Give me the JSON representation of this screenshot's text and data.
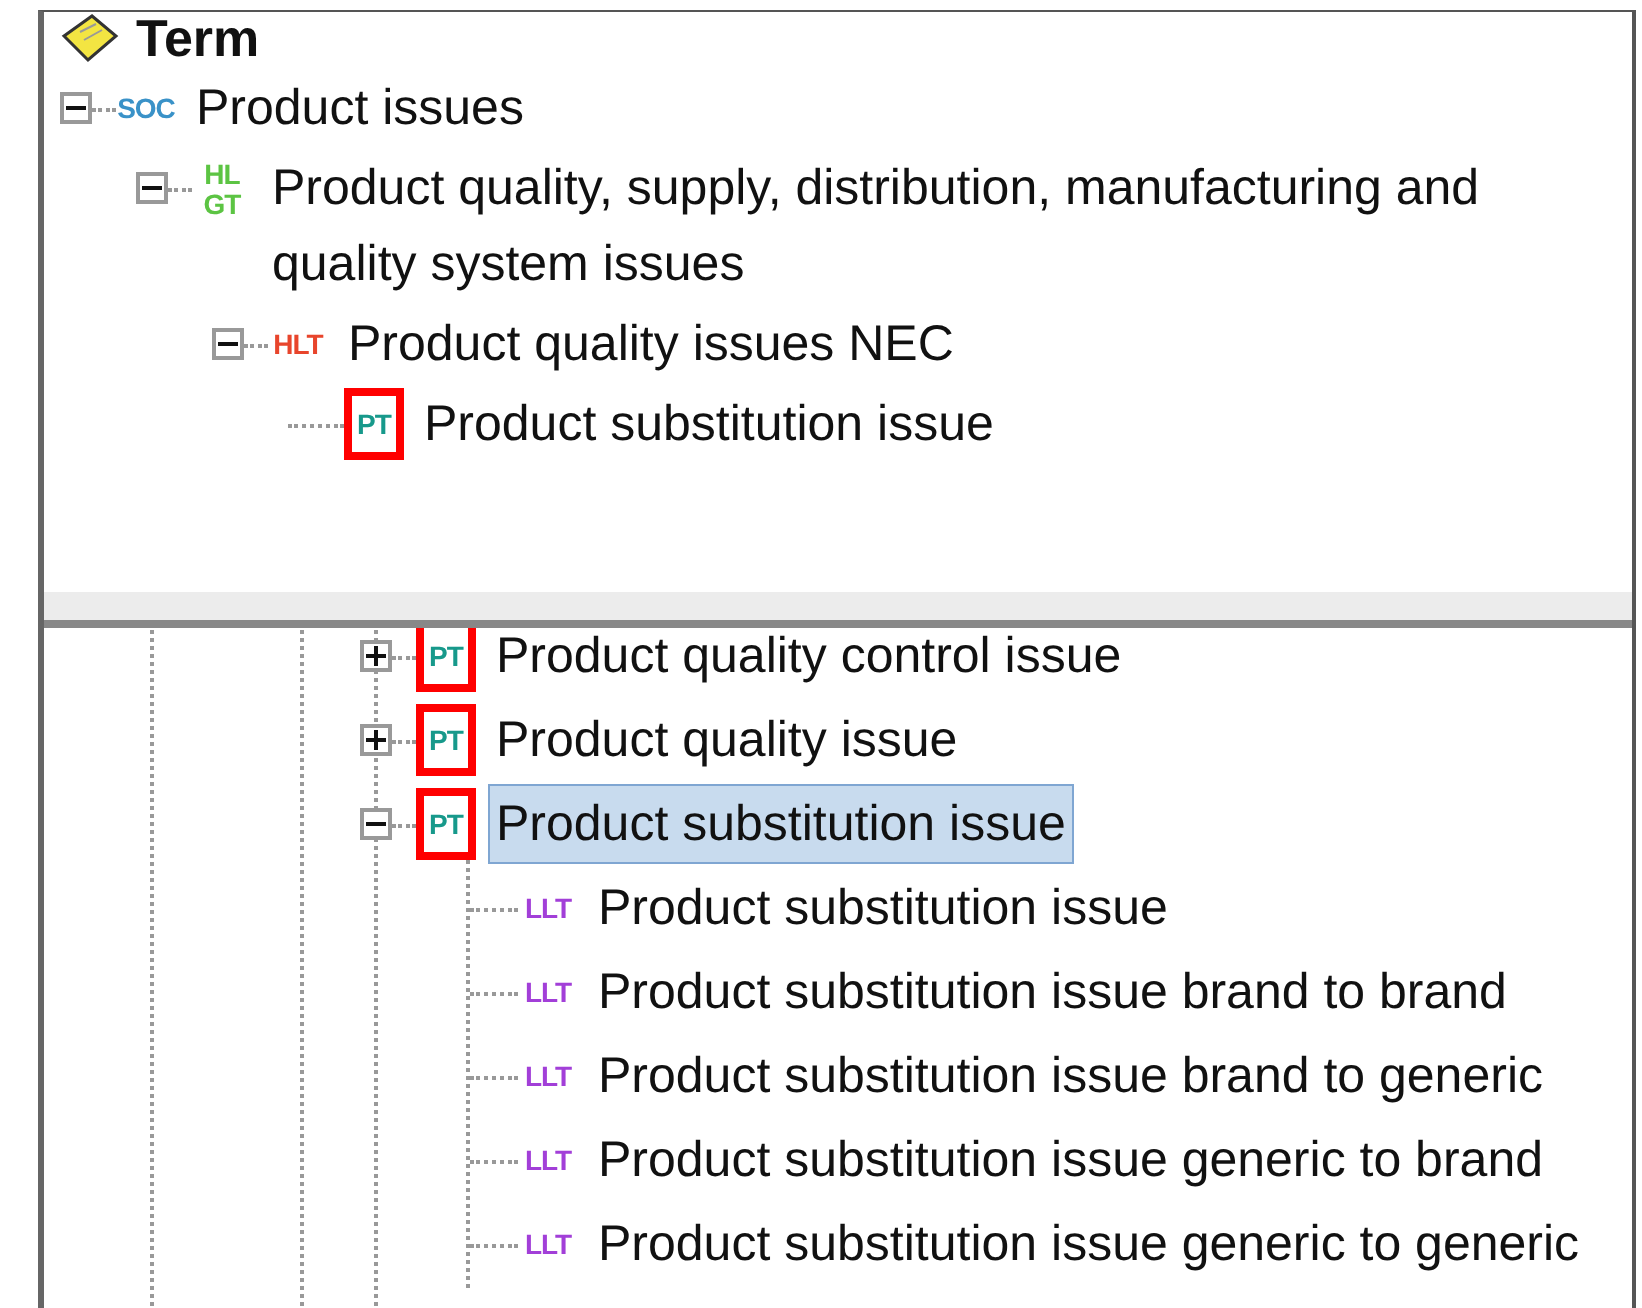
{
  "header": {
    "title": "Term"
  },
  "hierarchy": [
    {
      "kind": "soc",
      "code_lines": [
        "SOC"
      ],
      "label": "Product issues",
      "expanded": true,
      "flagged": false,
      "children": [
        {
          "kind": "hlgt",
          "code_lines": [
            "HL",
            "GT"
          ],
          "label": "Product quality, supply, distribution, manufacturing and quality system issues",
          "expanded": true,
          "flagged": false,
          "children": [
            {
              "kind": "hlt",
              "code_lines": [
                "HLT"
              ],
              "label": "Product quality issues NEC",
              "expanded": true,
              "flagged": false,
              "children": [
                {
                  "kind": "pt",
                  "code_lines": [
                    "PT"
                  ],
                  "label": "Product substitution issue",
                  "flagged": true
                }
              ]
            }
          ]
        }
      ]
    }
  ],
  "detail_tree": [
    {
      "kind": "pt",
      "code_lines": [
        "PT"
      ],
      "label": "Product quality control issue",
      "expanded": false,
      "flagged": true,
      "selected": false
    },
    {
      "kind": "pt",
      "code_lines": [
        "PT"
      ],
      "label": "Product quality issue",
      "expanded": false,
      "flagged": true,
      "selected": false
    },
    {
      "kind": "pt",
      "code_lines": [
        "PT"
      ],
      "label": "Product substitution issue",
      "expanded": true,
      "flagged": true,
      "selected": true,
      "children": [
        {
          "kind": "llt",
          "code_lines": [
            "LLT"
          ],
          "label": "Product substitution issue"
        },
        {
          "kind": "llt",
          "code_lines": [
            "LLT"
          ],
          "label": "Product substitution issue brand to brand"
        },
        {
          "kind": "llt",
          "code_lines": [
            "LLT"
          ],
          "label": "Product substitution issue brand to generic"
        },
        {
          "kind": "llt",
          "code_lines": [
            "LLT"
          ],
          "label": "Product substitution issue generic to brand"
        },
        {
          "kind": "llt",
          "code_lines": [
            "LLT"
          ],
          "label": "Product substitution issue generic to generic"
        }
      ]
    }
  ]
}
